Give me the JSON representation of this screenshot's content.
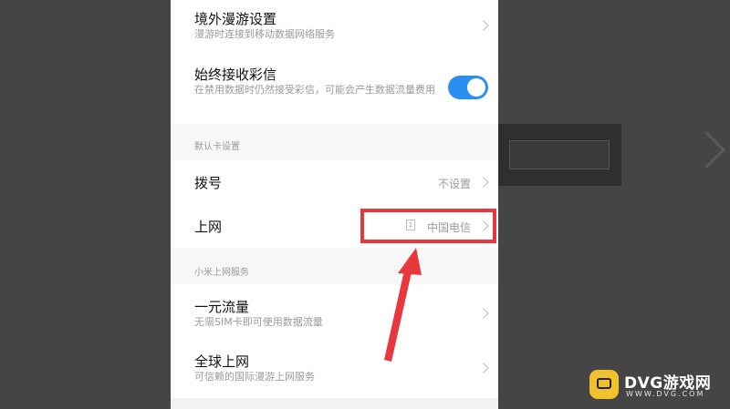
{
  "background": {
    "title": ""
  },
  "settings": {
    "roaming": {
      "title": "境外漫游设置",
      "subtitle": "漫游时连接到移动数据网络服务"
    },
    "mms": {
      "title": "始终接收彩信",
      "subtitle": "在禁用数据时仍然接受彩信，可能会产生数据流量费用",
      "enabled": true
    },
    "default_card_header": "默认卡设置",
    "dial": {
      "title": "拨号",
      "value": "不设置"
    },
    "internet": {
      "title": "上网",
      "sim_slot": "1",
      "value": "中国电信"
    },
    "xiaomi_header": "小米上网服务",
    "one_yuan": {
      "title": "一元流量",
      "subtitle": "无需SIM卡即可使用数据流量"
    },
    "global": {
      "title": "全球上网",
      "subtitle": "可信赖的国际漫游上网服务"
    }
  },
  "watermark": {
    "brand": "DVG游戏网",
    "url": "WWW.DVG.COM"
  },
  "colors": {
    "toggle_on": "#2a8ff0",
    "annotation": "#e8383d",
    "logo": "#f2c12e"
  }
}
